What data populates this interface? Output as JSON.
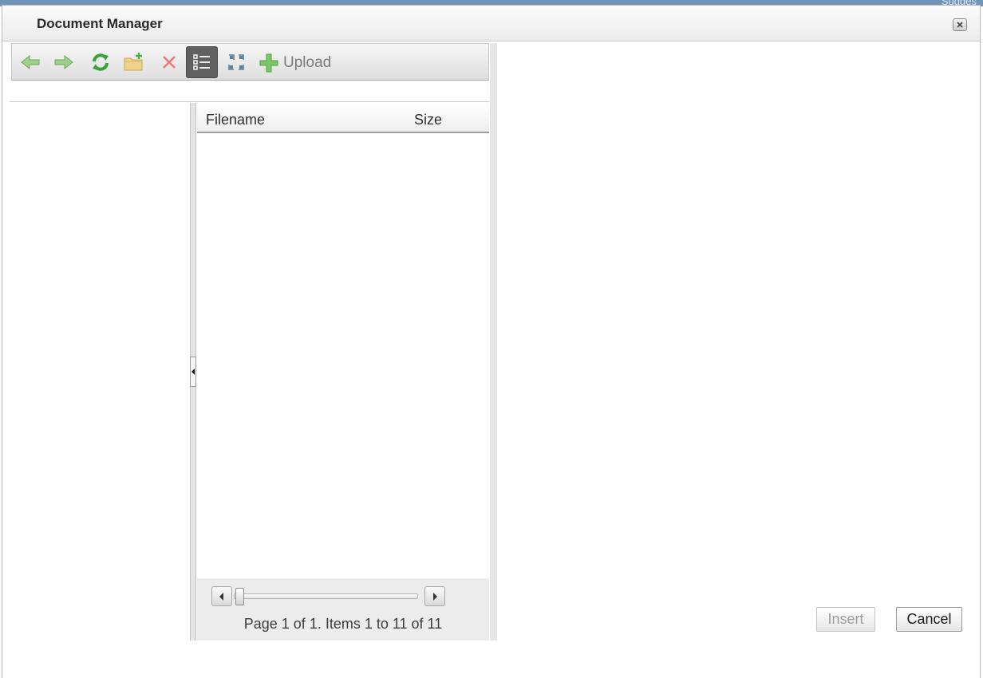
{
  "background": {
    "partial_text": "Sugges"
  },
  "window": {
    "title": "Document Manager"
  },
  "toolbar": {
    "buttons": [
      {
        "name": "back",
        "icon": "arrow-left-icon"
      },
      {
        "name": "forward",
        "icon": "arrow-right-icon"
      },
      {
        "name": "refresh",
        "icon": "refresh-icon"
      },
      {
        "name": "new-folder",
        "icon": "new-folder-icon"
      },
      {
        "name": "delete",
        "icon": "delete-icon"
      },
      {
        "name": "list-view",
        "icon": "list-view-icon",
        "active": true
      },
      {
        "name": "thumbnail-view",
        "icon": "thumbnail-view-icon"
      }
    ],
    "upload_label": "Upload"
  },
  "grid": {
    "columns": [
      "Filename",
      "Size"
    ],
    "rows": []
  },
  "pager": {
    "text": "Page 1 of 1. Items 1 to 11 of 11",
    "page": 1,
    "pages": 1,
    "item_from": 1,
    "item_to": 11,
    "items_total": 11
  },
  "buttons": {
    "insert_label": "Insert",
    "cancel_label": "Cancel"
  },
  "colors": {
    "accent_green": "#6cb33f",
    "delete_red": "#e05a5a",
    "active_button": "#606060"
  }
}
